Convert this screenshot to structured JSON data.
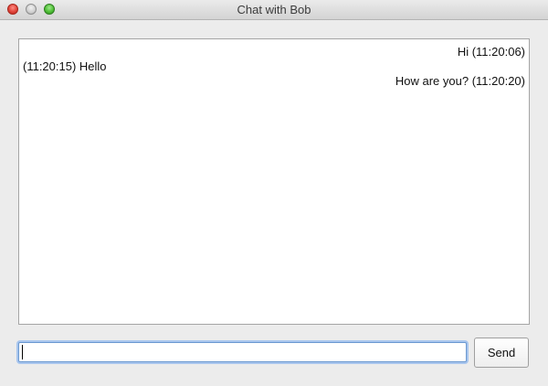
{
  "window": {
    "title": "Chat with Bob"
  },
  "chat": {
    "messages": [
      {
        "text": "Hi (11:20:06)",
        "align": "right"
      },
      {
        "text": "(11:20:15) Hello",
        "align": "left"
      },
      {
        "text": "How are you? (11:20:20)",
        "align": "right"
      }
    ]
  },
  "composer": {
    "input_value": "",
    "send_label": "Send"
  },
  "colors": {
    "window_background": "#ececec",
    "chat_background": "#ffffff",
    "focus_ring": "#a9c6ee",
    "close_button": "#e0443a",
    "maximize_button": "#4fbf37"
  },
  "icons": [
    "close-icon",
    "minimize-icon",
    "maximize-icon"
  ]
}
